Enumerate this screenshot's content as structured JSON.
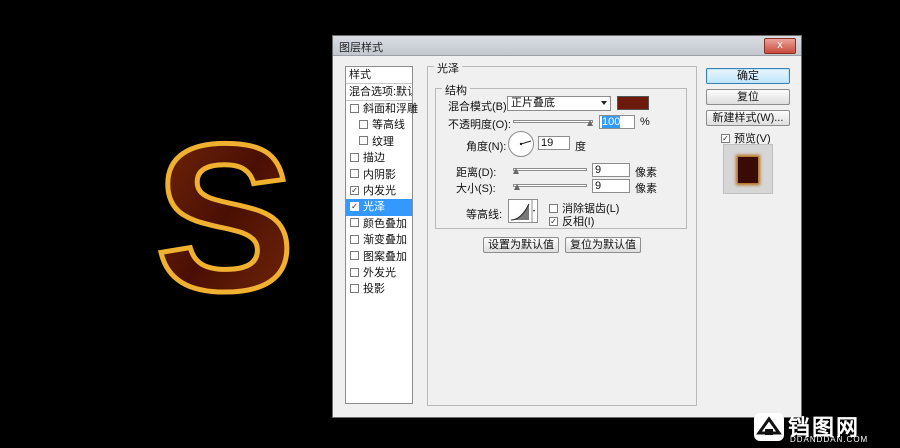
{
  "canvas": {
    "letter": "S"
  },
  "dialog": {
    "title": "图层样式",
    "close_label": "x",
    "styles_header": "样式",
    "blend_header": "混合选项:默认",
    "style_items": [
      {
        "label": "斜面和浮雕",
        "checked": false,
        "indent": false,
        "selected": false
      },
      {
        "label": "等高线",
        "checked": false,
        "indent": true,
        "selected": false
      },
      {
        "label": "纹理",
        "checked": false,
        "indent": true,
        "selected": false
      },
      {
        "label": "描边",
        "checked": false,
        "indent": false,
        "selected": false
      },
      {
        "label": "内阴影",
        "checked": false,
        "indent": false,
        "selected": false
      },
      {
        "label": "内发光",
        "checked": true,
        "indent": false,
        "selected": false
      },
      {
        "label": "光泽",
        "checked": true,
        "indent": false,
        "selected": true
      },
      {
        "label": "颜色叠加",
        "checked": false,
        "indent": false,
        "selected": false
      },
      {
        "label": "渐变叠加",
        "checked": false,
        "indent": false,
        "selected": false
      },
      {
        "label": "图案叠加",
        "checked": false,
        "indent": false,
        "selected": false
      },
      {
        "label": "外发光",
        "checked": false,
        "indent": false,
        "selected": false
      },
      {
        "label": "投影",
        "checked": false,
        "indent": false,
        "selected": false
      }
    ],
    "section_title": "光泽",
    "structure_title": "结构",
    "blend_mode_label": "混合模式(B):",
    "blend_mode_value": "正片叠底",
    "blend_color": "#6b1a0c",
    "opacity_label": "不透明度(O):",
    "opacity_value": "100",
    "opacity_unit": "%",
    "angle_label": "角度(N):",
    "angle_value": "19",
    "angle_unit": "度",
    "distance_label": "距离(D):",
    "distance_value": "9",
    "distance_unit": "像素",
    "size_label": "大小(S):",
    "size_value": "9",
    "size_unit": "像素",
    "contour_label": "等高线:",
    "antialias_label": "消除锯齿(L)",
    "antialias_checked": false,
    "invert_label": "反相(I)",
    "invert_checked": true,
    "make_default_label": "设置为默认值",
    "reset_default_label": "复位为默认值",
    "ok_label": "确定",
    "reset_label": "复位",
    "new_style_label": "新建样式(W)...",
    "preview_label": "预览(V)",
    "preview_checked": true
  },
  "watermark": {
    "text": "铛图网",
    "sub": "DDANDDAN.COM"
  }
}
